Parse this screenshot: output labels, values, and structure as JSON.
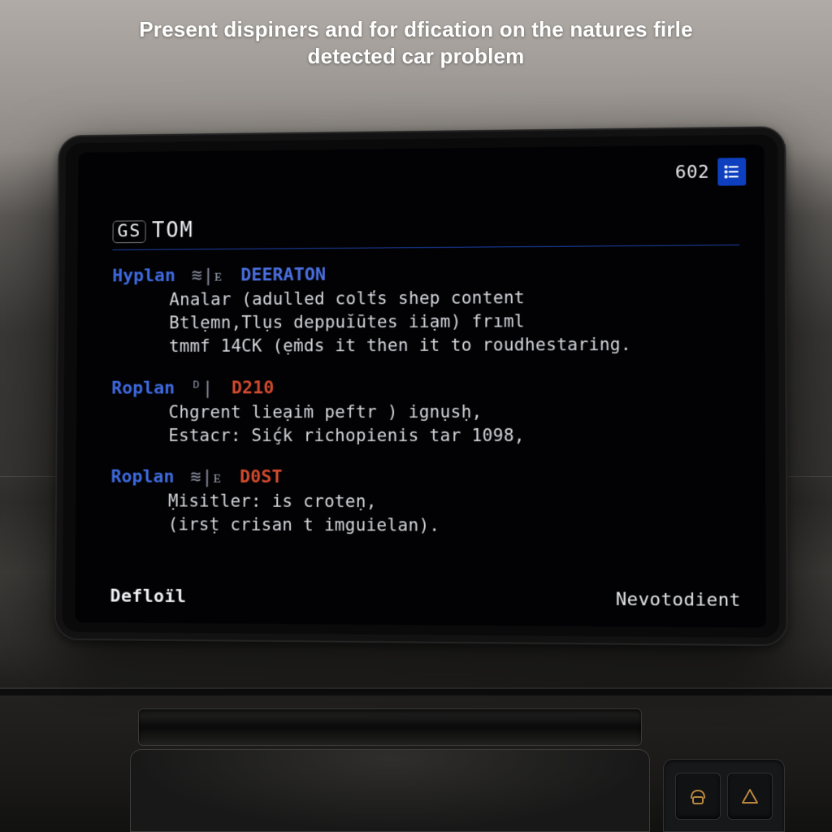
{
  "caption": "Present dispiners and for dfication on the natures firle detected car problem",
  "status": {
    "code": "602"
  },
  "section_title": {
    "mark": "GS",
    "text": "TOM"
  },
  "entries": [
    {
      "label_text": "Hyplan",
      "label_class": "blue",
      "glyphs": "≋|ᴇ",
      "code_text": "DEERATON",
      "code_class": "blue",
      "lines": [
        "Analar (adulled colťs shep content",
        "Btlẹmn,Tlụs deppuĭūtes iiạm) frıml",
        "tmmf 14CK (ẹṁds it then it to roudhestaring."
      ]
    },
    {
      "label_text": "Roplan",
      "label_class": "blue",
      "glyphs": "ᴰ|",
      "code_text": "D210",
      "code_class": "red",
      "lines": [
        "Chgrent lieạiṁ peftr ) ignụsḥ,",
        "Estacr: Siḉk richopienis tar 1098,"
      ]
    },
    {
      "label_text": "Roplan",
      "label_class": "blue",
      "glyphs": "≋|ᴇ",
      "code_text": "D0ST",
      "code_class": "red",
      "lines": [
        "Ṃisitler: is croteṇ,",
        "(irsṭ crisan t imguielan)."
      ]
    }
  ],
  "footer": {
    "left": "Defloïl",
    "right": "Nevotodient"
  }
}
